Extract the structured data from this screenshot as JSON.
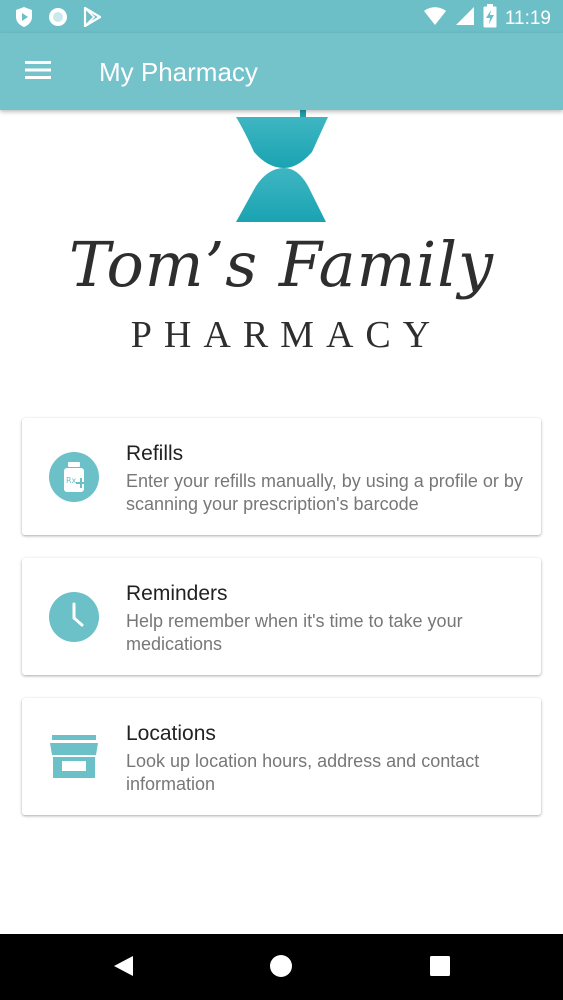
{
  "status_bar": {
    "time": "11:19",
    "left_icons": [
      "shield-play-icon",
      "circle-icon",
      "play-store-icon"
    ],
    "right_icons": [
      "wifi-icon",
      "signal-icon",
      "battery-charging-icon"
    ]
  },
  "app_bar": {
    "title": "My Pharmacy",
    "menu_icon": "hamburger-menu-icon"
  },
  "logo": {
    "script_text": "Tom’s Family",
    "sub_text": "PHARMACY",
    "mortar_color": "#27a9b6"
  },
  "cards": [
    {
      "title": "Refills",
      "description": "Enter your refills manually, by using a profile or by scanning your prescription's barcode",
      "icon": "rx-bottle-icon"
    },
    {
      "title": "Reminders",
      "description": "Help remember when it's time to take your medications",
      "icon": "clock-icon"
    },
    {
      "title": "Locations",
      "description": "Look up location hours, address and contact information",
      "icon": "store-icon"
    }
  ],
  "nav_bar": {
    "buttons": [
      "back-icon",
      "home-icon",
      "recents-icon"
    ]
  },
  "colors": {
    "app_bar": "#74c2ca",
    "status_bar": "#6cbec7",
    "icon_accent": "#6cc0c8"
  }
}
